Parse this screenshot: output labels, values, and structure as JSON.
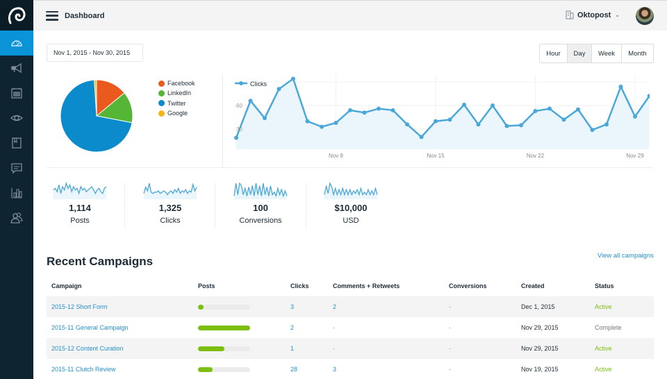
{
  "topbar": {
    "title": "Dashboard",
    "account_name": "Oktopost",
    "account_icon": "building-icon",
    "chevron": "⌄"
  },
  "sidebar": {
    "logo": "oktopost-logo",
    "items": [
      {
        "name": "dashboard",
        "icon": "speedometer-icon",
        "active": true
      },
      {
        "name": "campaigns",
        "icon": "megaphone-icon",
        "active": false
      },
      {
        "name": "calendar",
        "icon": "calendar-icon",
        "active": false
      },
      {
        "name": "monitor",
        "icon": "eye-icon",
        "active": false
      },
      {
        "name": "library",
        "icon": "bookmark-book-icon",
        "active": false
      },
      {
        "name": "inbox",
        "icon": "chat-icon",
        "active": false
      },
      {
        "name": "reports",
        "icon": "bar-chart-icon",
        "active": false
      },
      {
        "name": "users",
        "icon": "users-icon",
        "active": false
      }
    ]
  },
  "filters": {
    "date_range": "Nov 1, 2015 - Nov 30, 2015",
    "periods": [
      "Hour",
      "Day",
      "Week",
      "Month"
    ],
    "active_period": "Day"
  },
  "colors": {
    "facebook": "#ea5a1f",
    "linkedin": "#55b535",
    "twitter": "#0b8bcb",
    "google": "#f6b512",
    "line": "#4aa8d8",
    "active": "#7cbf10",
    "link": "#2490c9",
    "sidebar_active": "#0b93d8"
  },
  "chart_data": [
    {
      "type": "pie",
      "title": "",
      "legend_position": "right",
      "labels": [
        "Facebook",
        "LinkedIn",
        "Twitter",
        "Google"
      ],
      "values": [
        14,
        14,
        71,
        1
      ]
    },
    {
      "type": "area",
      "title": "",
      "legend": [
        "Clicks"
      ],
      "legend_position": "top-left",
      "x": [
        "Nov 1",
        "Nov 2",
        "Nov 3",
        "Nov 4",
        "Nov 5",
        "Nov 6",
        "Nov 7",
        "Nov 8",
        "Nov 9",
        "Nov 10",
        "Nov 11",
        "Nov 12",
        "Nov 13",
        "Nov 14",
        "Nov 15",
        "Nov 16",
        "Nov 17",
        "Nov 18",
        "Nov 19",
        "Nov 20",
        "Nov 21",
        "Nov 22",
        "Nov 23",
        "Nov 24",
        "Nov 25",
        "Nov 26",
        "Nov 27",
        "Nov 28",
        "Nov 29",
        "Nov 30"
      ],
      "series": [
        {
          "name": "Clicks",
          "values": [
            19,
            66,
            44,
            81,
            94,
            40,
            33,
            38,
            54,
            51,
            56,
            54,
            36,
            20,
            40,
            42,
            61,
            36,
            60,
            34,
            35,
            53,
            56,
            42,
            55,
            29,
            36,
            84,
            46,
            72
          ]
        }
      ],
      "x_ticks": [
        "Nov 8",
        "Nov 15",
        "Nov 22",
        "Nov 29"
      ],
      "y_ticks": [
        30,
        60
      ],
      "ylim": [
        0,
        95
      ],
      "grid": true,
      "xlabel": "",
      "ylabel": ""
    }
  ],
  "stats": [
    {
      "value": "1,114",
      "label": "Posts",
      "spark": [
        5,
        6,
        4,
        8,
        3,
        7,
        5,
        9,
        6,
        8,
        4,
        7,
        5,
        6,
        3,
        7,
        5,
        6,
        4,
        5,
        6,
        7,
        5,
        3,
        5,
        6,
        4,
        3,
        6,
        7
      ]
    },
    {
      "value": "1,325",
      "label": "Clicks",
      "spark": [
        4,
        9,
        6,
        12,
        5,
        4,
        5,
        5,
        6,
        4,
        5,
        6,
        5,
        3,
        5,
        6,
        4,
        7,
        5,
        8,
        4,
        6,
        5,
        7,
        4,
        6,
        5,
        11,
        6,
        9
      ]
    },
    {
      "value": "100",
      "label": "Conversions",
      "spark": [
        2,
        12,
        3,
        12,
        10,
        3,
        8,
        2,
        9,
        3,
        10,
        2,
        12,
        3,
        10,
        2,
        12,
        3,
        9,
        2,
        10,
        3,
        5,
        2,
        8,
        3,
        7,
        2,
        6,
        2
      ]
    },
    {
      "value": "$10,000",
      "label": "USD",
      "spark": [
        3,
        10,
        4,
        12,
        9,
        3,
        8,
        3,
        7,
        3,
        8,
        3,
        7,
        3,
        7,
        3,
        6,
        4,
        7,
        3,
        8,
        3,
        5,
        3,
        7,
        3,
        6,
        3,
        8,
        3
      ]
    }
  ],
  "campaigns": {
    "title": "Recent Campaigns",
    "view_all": "View all campaigns",
    "columns": [
      "Campaign",
      "Posts",
      "Clicks",
      "Comments + Retweets",
      "Conversions",
      "Created",
      "Status"
    ],
    "rows": [
      {
        "name": "2015-12 Short Form",
        "posts_fraction": 0.1,
        "clicks": "3",
        "comments": "2",
        "conversions": "-",
        "created": "Dec 1, 2015",
        "status": "Active"
      },
      {
        "name": "2015-11 General Campaign",
        "posts_fraction": 1.0,
        "clicks": "2",
        "comments": "-",
        "conversions": "-",
        "created": "Nov 29, 2015",
        "status": "Complete"
      },
      {
        "name": "2015-12 Content Curation",
        "posts_fraction": 0.5,
        "clicks": "1",
        "comments": "-",
        "conversions": "-",
        "created": "Nov 29, 2015",
        "status": "Active"
      },
      {
        "name": "2015-11 Clutch Review",
        "posts_fraction": 0.28,
        "clicks": "28",
        "comments": "3",
        "conversions": "-",
        "created": "Nov 19, 2015",
        "status": "Active"
      }
    ]
  }
}
